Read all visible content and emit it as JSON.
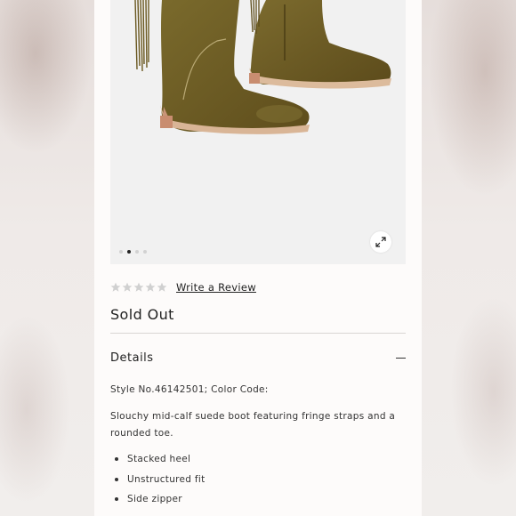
{
  "product": {
    "rating": {
      "stars_filled": 0,
      "stars_total": 5,
      "review_link": "Write a Review"
    },
    "status": "Sold Out",
    "gallery": {
      "image_count": 4,
      "active_index": 1,
      "zoom_icon": "expand-icon"
    }
  },
  "details": {
    "title": "Details",
    "toggle_icon": "minus-icon",
    "style_line": "Style No.46142501; Color Code:",
    "description": "Slouchy mid-calf suede boot featuring fringe straps and a rounded toe.",
    "features": [
      "Stacked heel",
      "Unstructured fit",
      "Side zipper"
    ]
  },
  "colors": {
    "suede": "#6b5a22",
    "sole": "#d9b596",
    "page": "#fdfbfa",
    "gallery_bg": "#f1f1f1"
  }
}
